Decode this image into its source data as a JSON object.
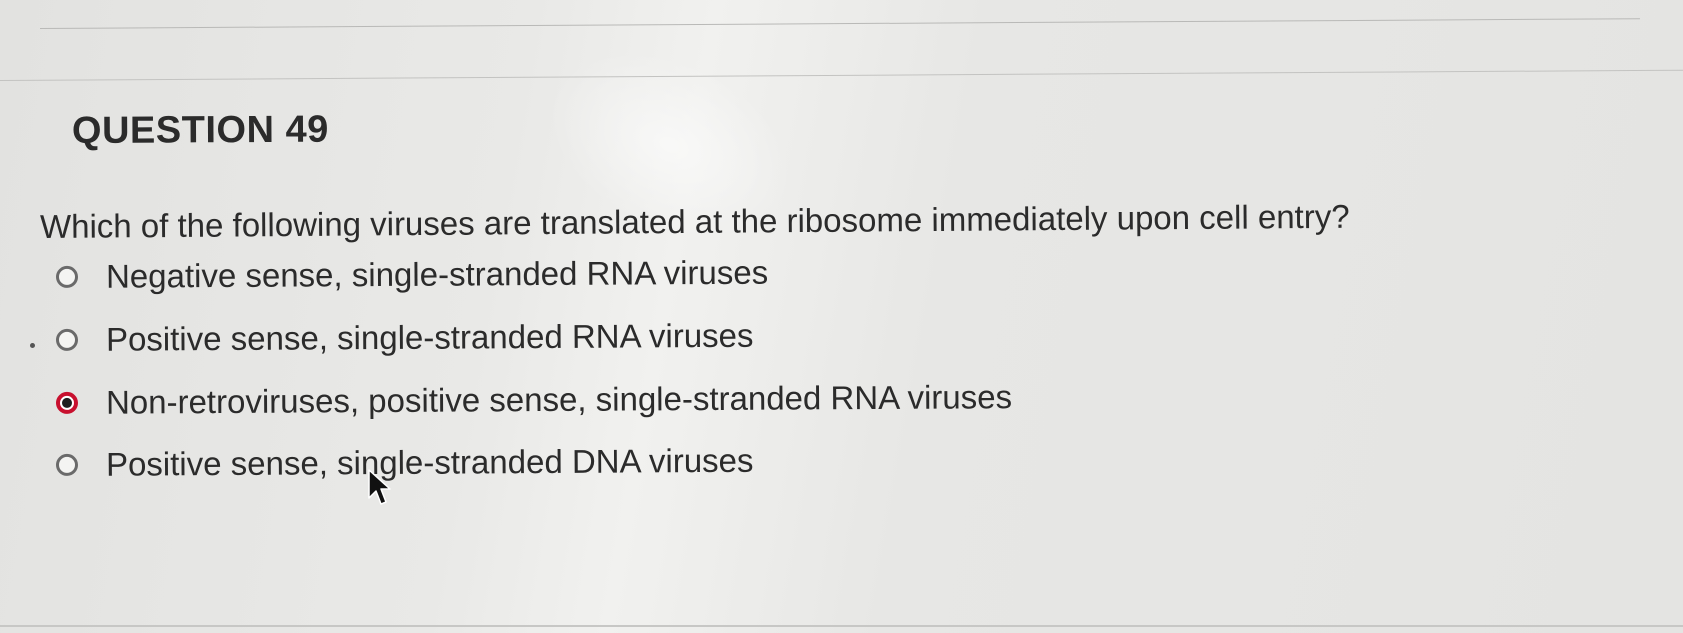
{
  "question": {
    "title": "QUESTION 49",
    "text": "Which of the following viruses are translated at the ribosome immediately upon cell entry?"
  },
  "options": [
    {
      "label": "Negative sense, single-stranded RNA viruses",
      "selected": false
    },
    {
      "label": "Positive sense, single-stranded RNA viruses",
      "selected": false
    },
    {
      "label": "Non-retroviruses, positive sense, single-stranded RNA viruses",
      "selected": true
    },
    {
      "label": "Positive sense, single-stranded DNA viruses",
      "selected": false
    }
  ],
  "colors": {
    "selected_radio_ring": "#c8102e",
    "text": "#2b2b2b",
    "background": "#e6e6e4"
  },
  "icons": {
    "cursor": "arrow-pointer-icon",
    "radio": "radio-button-icon"
  }
}
